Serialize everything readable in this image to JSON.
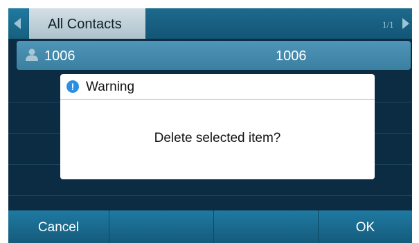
{
  "header": {
    "tab_label": "All Contacts",
    "page_indicator": "1/1"
  },
  "contacts": [
    {
      "name": "1006",
      "number": "1006"
    }
  ],
  "dialog": {
    "title": "Warning",
    "message": "Delete selected item?"
  },
  "softkeys": [
    {
      "label": "Cancel"
    },
    {
      "label": ""
    },
    {
      "label": ""
    },
    {
      "label": "OK"
    }
  ],
  "icons": {
    "nav_left": "triangle-left-icon",
    "nav_right": "triangle-right-icon",
    "contact": "person-icon",
    "warning": "info-icon"
  },
  "colors": {
    "screen_bg": "#0c2c44",
    "tab_active": "#c4d4dc",
    "row_highlight": "#4a8fb1",
    "softkey_bg": "#1a6c91",
    "warning_icon": "#2a8fe0"
  }
}
